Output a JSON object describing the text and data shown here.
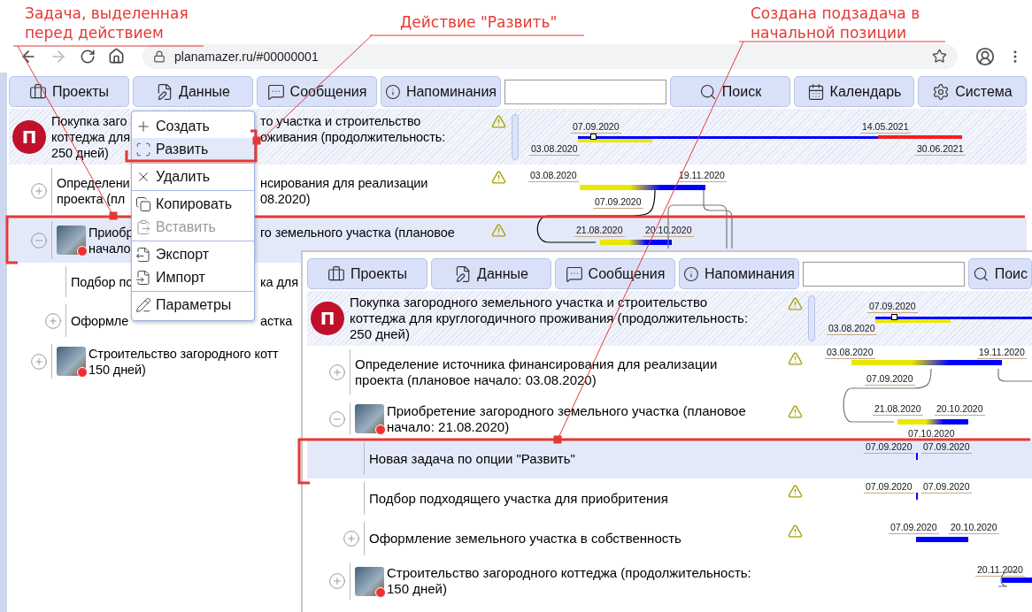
{
  "annotations": [
    {
      "text": "Задача, выделенная\nперед действием"
    },
    {
      "text": "Действие \"Развить\""
    },
    {
      "text": "Создана подзадача в\nначальной позиции"
    }
  ],
  "browser": {
    "url": "planamazer.ru/#00000001"
  },
  "app": {
    "nav": [
      {
        "kind": "button",
        "label": "Проекты"
      },
      {
        "kind": "button",
        "label": "Данные"
      },
      {
        "kind": "button",
        "label": "Сообщения"
      },
      {
        "kind": "button",
        "label": "Напоминания"
      },
      {
        "kind": "field"
      },
      {
        "kind": "button",
        "label": "Поиск"
      },
      {
        "kind": "button",
        "label": "Календарь"
      },
      {
        "kind": "button",
        "label": "Система"
      }
    ],
    "tasks": [
      {
        "kind": "project",
        "logo": "П",
        "lines": [
          [
            "Покупка заго",
            "то участка и строительство"
          ],
          [
            "коттеджа для",
            "оживания (продолжительность:"
          ],
          [
            "250 дней)"
          ]
        ],
        "warning": true,
        "selected": false,
        "dates": [
          "07.09.2020",
          "14.05.2021",
          "03.08.2020",
          "30.06.2021"
        ],
        "children": [
          {
            "kind": "task",
            "expanded": false,
            "lines": [
              [
                "Определени",
                "нсирования для реализации"
              ],
              [
                "проекта (пл",
                "08.2020)"
              ]
            ],
            "warning": true,
            "selected": false,
            "dates": [
              "03.08.2020",
              "19.11.2020",
              "07.09.2020"
            ]
          },
          {
            "kind": "task",
            "expanded": true,
            "photo": true,
            "lines": [
              [
                "Приобр",
                "го земельного участка (плановое"
              ],
              [
                "начало"
              ]
            ],
            "warning": true,
            "selected": true,
            "dates": [
              "21.08.2020",
              "20.10.2020"
            ],
            "children": [
              {
                "kind": "task",
                "lines": [
                  [
                    "Подбор по",
                    "ка для"
                  ]
                ],
                "selected": false
              },
              {
                "kind": "task",
                "expanded": false,
                "lines": [
                  [
                    "Оформле",
                    "астка"
                  ]
                ],
                "selected": false
              }
            ]
          },
          {
            "kind": "task",
            "expanded": false,
            "photo": true,
            "lines": [
              [
                "Строительство загородного котт"
              ],
              [
                "150 дней)"
              ]
            ],
            "selected": false
          }
        ]
      }
    ]
  },
  "context_menu": {
    "groups": [
      [
        {
          "label": "Создать",
          "selected": false,
          "disabled": false
        },
        {
          "label": "Развить",
          "selected": true,
          "disabled": false
        }
      ],
      [
        {
          "label": "Удалить",
          "selected": false,
          "disabled": false
        }
      ],
      [
        {
          "label": "Копировать",
          "selected": false,
          "disabled": false
        },
        {
          "label": "Вставить",
          "selected": false,
          "disabled": true
        }
      ],
      [
        {
          "label": "Экспорт",
          "selected": false,
          "disabled": false
        },
        {
          "label": "Импорт",
          "selected": false,
          "disabled": false
        }
      ],
      [
        {
          "label": "Параметры",
          "selected": false,
          "disabled": false
        }
      ]
    ]
  },
  "inset_window": {
    "nav": [
      {
        "kind": "button",
        "label": "Проекты"
      },
      {
        "kind": "button",
        "label": "Данные"
      },
      {
        "kind": "button",
        "label": "Сообщения"
      },
      {
        "kind": "button",
        "label": "Напоминания"
      },
      {
        "kind": "field"
      },
      {
        "kind": "button",
        "label": "Поис"
      }
    ],
    "tasks": [
      {
        "kind": "project",
        "logo": "П",
        "title": "Покупка загородного земельного участка и строительство\nкоттеджа для круглогодичного проживания (продолжительность:\n250 дней)",
        "warning": true,
        "selected": false,
        "dates": [
          "07.09.2020",
          "03.08.2020"
        ],
        "children": [
          {
            "kind": "task",
            "expanded": false,
            "title": "Определение источника финансирования для реализации\nпроекта (плановое начало: 03.08.2020)",
            "warning": true,
            "selected": false,
            "dates": [
              "03.08.2020",
              "19.11.2020",
              "07.09.2020"
            ]
          },
          {
            "kind": "task",
            "expanded": true,
            "photo": true,
            "title": "Приобретение загородного земельного участка (плановое\nначало: 21.08.2020)",
            "warning": true,
            "selected": false,
            "dates": [
              "21.08.2020",
              "20.10.2020",
              "07.10.2020"
            ],
            "children": [
              {
                "kind": "task",
                "title": "Новая задача по опции \"Развить\"",
                "selected": true,
                "dates": [
                  "07.09.2020",
                  "07.09.2020"
                ]
              },
              {
                "kind": "task",
                "title": "Подбор подходящего участка для приобритения",
                "warning": true,
                "selected": false,
                "dates": [
                  "07.09.2020",
                  "07.09.2020"
                ]
              },
              {
                "kind": "task",
                "expanded": false,
                "title": "Оформление земельного участка в собственность",
                "warning": true,
                "selected": false,
                "dates": [
                  "07.09.2020",
                  "20.10.2020"
                ]
              }
            ]
          },
          {
            "kind": "task",
            "expanded": false,
            "photo": true,
            "title": "Строительство загородного коттеджа (продолжительность:\n150 дней)",
            "selected": false,
            "dates": [
              "20.11.2020"
            ]
          }
        ]
      }
    ]
  }
}
